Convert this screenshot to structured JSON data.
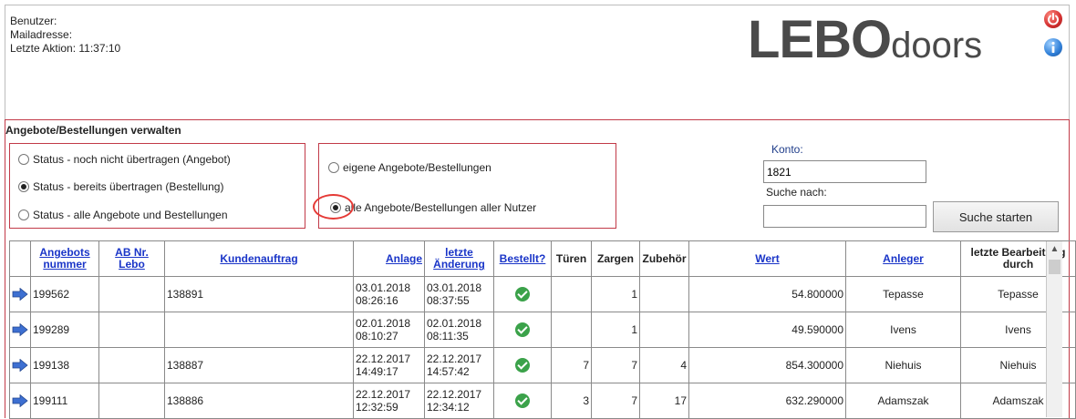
{
  "user_info": {
    "benutzer_label": "Benutzer:",
    "mail_label": "Mailadresse:",
    "last_action": "Letzte Aktion: 11:37:10"
  },
  "logo": {
    "strong": "LEBO",
    "light": "doors"
  },
  "icons": {
    "power": "power-icon",
    "info": "info-icon"
  },
  "section": {
    "title": "Angebote/Bestellungen verwalten"
  },
  "status_filter": {
    "options": [
      {
        "label": "Status - noch nicht übertragen (Angebot)",
        "checked": false
      },
      {
        "label": "Status - bereits übertragen (Bestellung)",
        "checked": true
      },
      {
        "label": "Status - alle Angebote und Bestellungen",
        "checked": false
      }
    ]
  },
  "owner_filter": {
    "options": [
      {
        "label": "eigene Angebote/Bestellungen",
        "checked": false
      },
      {
        "label": "alle Angebote/Bestellungen aller Nutzer",
        "checked": true
      }
    ]
  },
  "search": {
    "konto_label": "Konto:",
    "konto_value": "1821",
    "suche_label": "Suche nach:",
    "suche_value": "",
    "button_label": "Suche starten"
  },
  "table": {
    "headers": {
      "angebotsnummer": "Angebots nummer",
      "ab_nr": "AB Nr. Lebo",
      "kundenauftrag": "Kundenauftrag",
      "anlage": "Anlage",
      "letzte_aenderung": "letzte Änderung",
      "bestellt": "Bestellt?",
      "tueren": "Türen",
      "zargen": "Zargen",
      "zubehoer": "Zubehör",
      "wert": "Wert",
      "anleger": "Anleger",
      "letzte_bearbeitung": "letzte Bearbeitung durch"
    },
    "rows": [
      {
        "nummer": "199562",
        "ab_nr": "",
        "kundenauftrag": "138891",
        "anlage_date": "03.01.2018",
        "anlage_time": "08:26:16",
        "aend_date": "03.01.2018",
        "aend_time": "08:37:55",
        "bestellt": true,
        "tueren": "",
        "zargen": "1",
        "zubehoer": "",
        "wert": "54.800000",
        "anleger": "Tepasse",
        "bearbeitung": "Tepasse"
      },
      {
        "nummer": "199289",
        "ab_nr": "",
        "kundenauftrag": "",
        "anlage_date": "02.01.2018",
        "anlage_time": "08:10:27",
        "aend_date": "02.01.2018",
        "aend_time": "08:11:35",
        "bestellt": true,
        "tueren": "",
        "zargen": "1",
        "zubehoer": "",
        "wert": "49.590000",
        "anleger": "Ivens",
        "bearbeitung": "Ivens"
      },
      {
        "nummer": "199138",
        "ab_nr": "",
        "kundenauftrag": "138887",
        "anlage_date": "22.12.2017",
        "anlage_time": "14:49:17",
        "aend_date": "22.12.2017",
        "aend_time": "14:57:42",
        "bestellt": true,
        "tueren": "7",
        "zargen": "7",
        "zubehoer": "4",
        "wert": "854.300000",
        "anleger": "Niehuis",
        "bearbeitung": "Niehuis"
      },
      {
        "nummer": "199111",
        "ab_nr": "",
        "kundenauftrag": "138886",
        "anlage_date": "22.12.2017",
        "anlage_time": "12:32:59",
        "aend_date": "22.12.2017",
        "aend_time": "12:34:12",
        "bestellt": true,
        "tueren": "3",
        "zargen": "7",
        "zubehoer": "17",
        "wert": "632.290000",
        "anleger": "Adamszak",
        "bearbeitung": "Adamszak"
      }
    ]
  }
}
